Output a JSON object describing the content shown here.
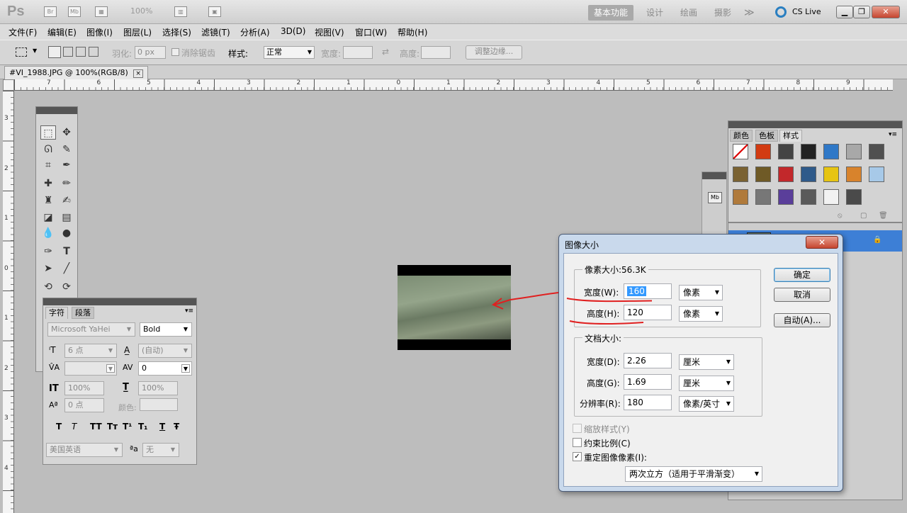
{
  "app": {
    "logo": "Ps",
    "zoom": "100%",
    "workspaces": [
      "基本功能",
      "设计",
      "绘画",
      "摄影"
    ],
    "more": "≫",
    "cslive": "CS Live"
  },
  "menu": [
    "文件(F)",
    "编辑(E)",
    "图像(I)",
    "图层(L)",
    "选择(S)",
    "滤镜(T)",
    "分析(A)",
    "3D(D)",
    "视图(V)",
    "窗口(W)",
    "帮助(H)"
  ],
  "options": {
    "feather_label": "羽化:",
    "feather_value": "0 px",
    "antialias_label": "消除锯齿",
    "style_label": "样式:",
    "style_value": "正常",
    "width_label": "宽度:",
    "height_label": "高度:",
    "refine_button": "调整边缘..."
  },
  "document": {
    "tab_title": "#VI_1988.JPG @ 100%(RGB/8)",
    "tab_close": "×"
  },
  "rulers": {
    "h_ticks": [
      "7",
      "6",
      "5",
      "4",
      "3",
      "2",
      "1",
      "0",
      "1",
      "2",
      "3",
      "4",
      "5",
      "6",
      "7",
      "8",
      "9"
    ],
    "v_ticks": [
      "3",
      "2",
      "1",
      "0",
      "1",
      "2",
      "3",
      "4"
    ]
  },
  "character_panel": {
    "tabs": [
      "字符",
      "段落"
    ],
    "font_family": "Microsoft YaHei",
    "font_style": "Bold",
    "font_size": "6 点",
    "leading": "(自动)",
    "tracking": "0",
    "vert_scale": "100%",
    "horiz_scale": "100%",
    "baseline": "0 点",
    "color_label": "颜色:",
    "typo_buttons": [
      "T",
      "T",
      "TT",
      "Tт",
      "T¹",
      "T₁",
      "T",
      "Ŧ"
    ],
    "language": "美国英语",
    "aa_label": "ªa",
    "aa_value": "无"
  },
  "styles_panel": {
    "tabs": [
      "颜色",
      "色板",
      "样式"
    ],
    "swatch_colors": [
      "#ffffff",
      "#d23b12",
      "#444444",
      "#222222",
      "#2f78c7",
      "#a8a8a8",
      "#505050",
      "#7a6232",
      "#6f5a26",
      "#c2282b",
      "#2f5a8a",
      "#e6c412",
      "#d8832c",
      "#a7c9e8",
      "#b07a3b",
      "#777777",
      "#5a3e9a",
      "#5a5a5a",
      "#f2f2f2",
      "#4a4a4a"
    ]
  },
  "dialog": {
    "title": "图像大小",
    "close": "✕",
    "pixel_dim_label": "像素大小:56.3K",
    "width_label": "宽度(W):",
    "width_value": "160",
    "width_unit": "像素",
    "height_label": "高度(H):",
    "height_value": "120",
    "height_unit": "像素",
    "doc_size_label": "文档大小:",
    "doc_width_label": "宽度(D):",
    "doc_width_value": "2.26",
    "doc_width_unit": "厘米",
    "doc_height_label": "高度(G):",
    "doc_height_value": "1.69",
    "doc_height_unit": "厘米",
    "resolution_label": "分辨率(R):",
    "resolution_value": "180",
    "resolution_unit": "像素/英寸",
    "scale_styles": "缩放样式(Y)",
    "constrain": "约束比例(C)",
    "resample": "重定图像像素(I):",
    "resample_method": "两次立方（适用于平滑渐变）",
    "ok": "确定",
    "cancel": "取消",
    "auto": "自动(A)...",
    "resample_checked": "✓"
  }
}
